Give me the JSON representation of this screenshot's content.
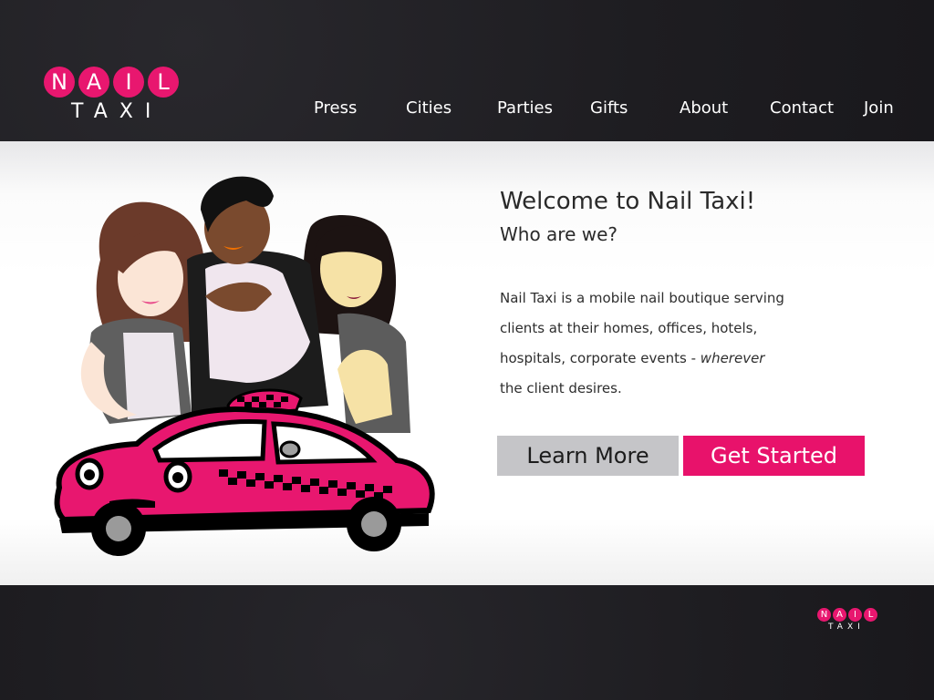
{
  "logo": {
    "letters": [
      "N",
      "A",
      "I",
      "L"
    ],
    "sub": "TAXI"
  },
  "nav": {
    "items": [
      {
        "label": "Press"
      },
      {
        "label": "Cities"
      },
      {
        "label": "Parties"
      },
      {
        "label": "Gifts"
      },
      {
        "label": "About"
      },
      {
        "label": "Contact"
      },
      {
        "label": "Join"
      }
    ]
  },
  "hero": {
    "title": "Welcome to Nail Taxi!",
    "subtitle": "Who are we?",
    "paragraph": {
      "line1": "Nail Taxi is a mobile nail boutique serving",
      "line2": "clients at their homes, offices, hotels,",
      "line3_prefix": "hospitals, corporate events - ",
      "line3_em": "wherever",
      "line4": "the client desires."
    },
    "learn_more_label": "Learn More",
    "get_started_label": "Get Started"
  },
  "footer": {
    "logo_letters": [
      "N",
      "A",
      "I",
      "L"
    ],
    "logo_sub": "TAXI"
  },
  "colors": {
    "brand_pink": "#e8126b",
    "header_bg": "#1f1e22",
    "button_gray": "#c5c5c8"
  }
}
